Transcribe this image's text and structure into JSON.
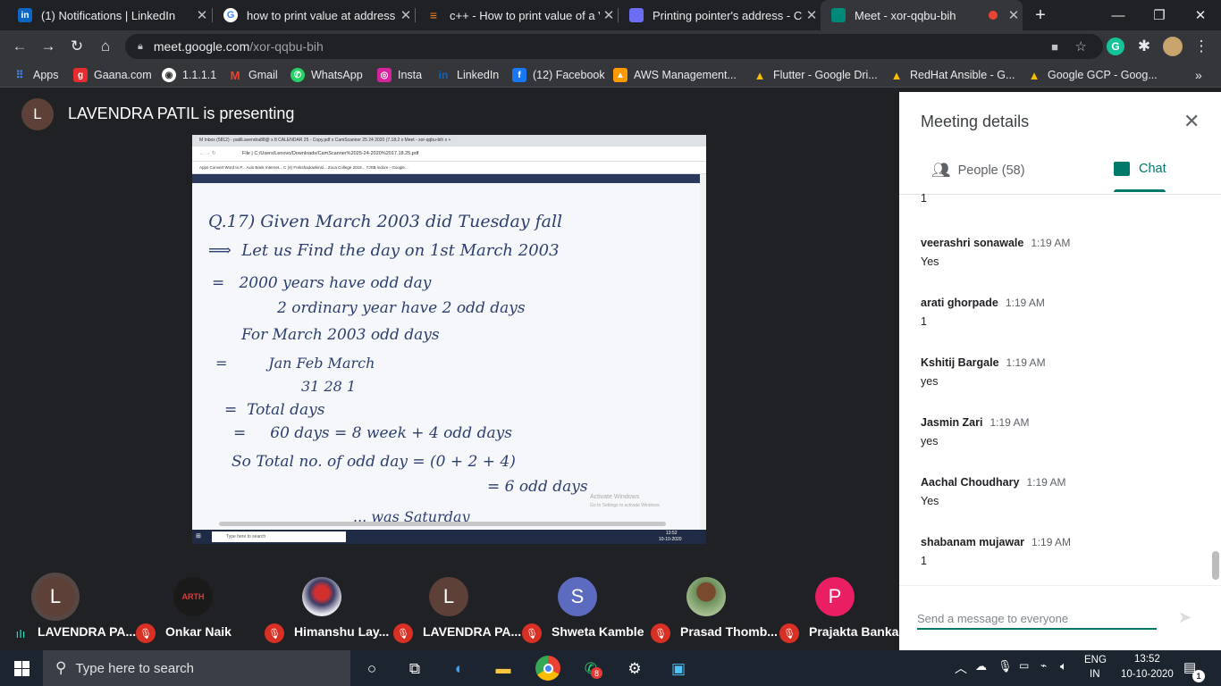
{
  "tabs": [
    {
      "title": "(1) Notifications | LinkedIn",
      "icon": "linkedin-icon",
      "color": "#0a66c2"
    },
    {
      "title": "how to print value at address i",
      "icon": "google-icon",
      "color": "#ffffff"
    },
    {
      "title": "c++ - How to print value of a V",
      "icon": "stackoverflow-icon",
      "color": "#f48024"
    },
    {
      "title": "Printing pointer's address - C+",
      "icon": "cplusplus-icon",
      "color": "#6d6df3"
    },
    {
      "title": "Meet - xor-qqbu-bih",
      "icon": "meet-icon",
      "color": "#00897b"
    }
  ],
  "url": {
    "host": "meet.google.com",
    "path": "/xor-qqbu-bih"
  },
  "bookmarks": [
    {
      "label": "Apps",
      "icon": "apps-grid-icon",
      "color": "#4285f4"
    },
    {
      "label": "Gaana.com",
      "icon": "gaana-icon",
      "color": "#e72c30"
    },
    {
      "label": "1.1.1.1",
      "icon": "globe-icon",
      "color": "#ffffff"
    },
    {
      "label": "Gmail",
      "icon": "gmail-icon",
      "color": "#ea4335"
    },
    {
      "label": "WhatsApp",
      "icon": "whatsapp-icon",
      "color": "#25d366"
    },
    {
      "label": "Insta",
      "icon": "instagram-icon",
      "color": "#d6249f"
    },
    {
      "label": "LinkedIn",
      "icon": "linkedin-icon",
      "color": "#0a66c2"
    },
    {
      "label": "(12) Facebook",
      "icon": "facebook-icon",
      "color": "#1877f2"
    },
    {
      "label": "AWS Management...",
      "icon": "aws-icon",
      "color": "#ff9900"
    },
    {
      "label": "Flutter - Google Dri...",
      "icon": "drive-icon",
      "color": "#fbbc04"
    },
    {
      "label": "RedHat Ansible - G...",
      "icon": "drive-icon",
      "color": "#fbbc04"
    },
    {
      "label": "Google GCP - Goog...",
      "icon": "drive-icon",
      "color": "#fbbc04"
    }
  ],
  "presenter": {
    "initial": "L",
    "text": "LAVENDRA PATIL is presenting"
  },
  "shared_screen": {
    "tabs": "M Inbox (5812) - patilLavendra88@  x   8 CALENDAR 25 - Copy.pdf  x   CamScanner 25 24 2020 (7.18.2  x   Meet - xor-qqbu-bih  x   +",
    "address": "File | C:/Users/Lenovo/Downloads/CamScanner%2025-24-2020%2017.18.25.pdf",
    "bookmarks": "Apps   Convert Word to P...   Axis Bank Internet...   C   (4) Frekshadowkinsl...   Zoca College 2018...   TJSB indore - Google...",
    "lines": [
      "Q.17)  Given   March 2003 did Tuesday fall",
      "Let us   Find the day   on 1st March 2003",
      "2000 years have odd day",
      "2 ordinary year have  2 odd days",
      "For March 2003  odd days",
      "Jan      Feb      March",
      "31       28       1",
      "Total days",
      "60 days  =  8 week + 4 odd days",
      "So  Total  no. of  odd day  =  (0 + 2 + 4)",
      "=  6  odd  days",
      "Activate Windows",
      "Go to Settings to activate Windows.",
      "... was Saturday"
    ],
    "taskbar_search": "Type here to search",
    "taskbar_time": "13:52",
    "taskbar_date": "10-10-2020"
  },
  "participants": [
    {
      "initial": "L",
      "name": "LAVENDRA PA...",
      "color": "#5d4037",
      "speaking": true
    },
    {
      "initial": "ARTH",
      "name": "Onkar Naik",
      "color": "#1a1a1a",
      "speaking": false
    },
    {
      "initial": "",
      "name": "Himanshu Lay...",
      "color": "#d8d8e8",
      "speaking": false
    },
    {
      "initial": "L",
      "name": "LAVENDRA PA...",
      "color": "#5d4037",
      "speaking": false
    },
    {
      "initial": "S",
      "name": "Shweta Kamble",
      "color": "#5c6bc0",
      "speaking": false
    },
    {
      "initial": "",
      "name": "Prasad Thomb...",
      "color": "#6b8e5a",
      "speaking": false
    },
    {
      "initial": "P",
      "name": "Prajakta Bankar",
      "color": "#e91e63",
      "speaking": false
    }
  ],
  "panel": {
    "title": "Meeting details",
    "people_tab": "People (58)",
    "chat_tab": "Chat",
    "first_partial": "1",
    "messages": [
      {
        "name": "veerashri sonawale",
        "time": "1:19 AM",
        "text": "Yes"
      },
      {
        "name": "arati ghorpade",
        "time": "1:19 AM",
        "text": "1"
      },
      {
        "name": "Kshitij Bargale",
        "time": "1:19 AM",
        "text": "yes"
      },
      {
        "name": "Jasmin Zari",
        "time": "1:19 AM",
        "text": "yes"
      },
      {
        "name": "Aachal Choudhary",
        "time": "1:19 AM",
        "text": "Yes"
      },
      {
        "name": "shabanam mujawar",
        "time": "1:19 AM",
        "text": "1"
      }
    ],
    "input_placeholder": "Send a message to everyone"
  },
  "taskbar": {
    "search_placeholder": "Type here to search",
    "whatsapp_badge": "8",
    "lang_top": "ENG",
    "lang_bottom": "IN",
    "time": "13:52",
    "date": "10-10-2020",
    "notif_count": "1"
  }
}
